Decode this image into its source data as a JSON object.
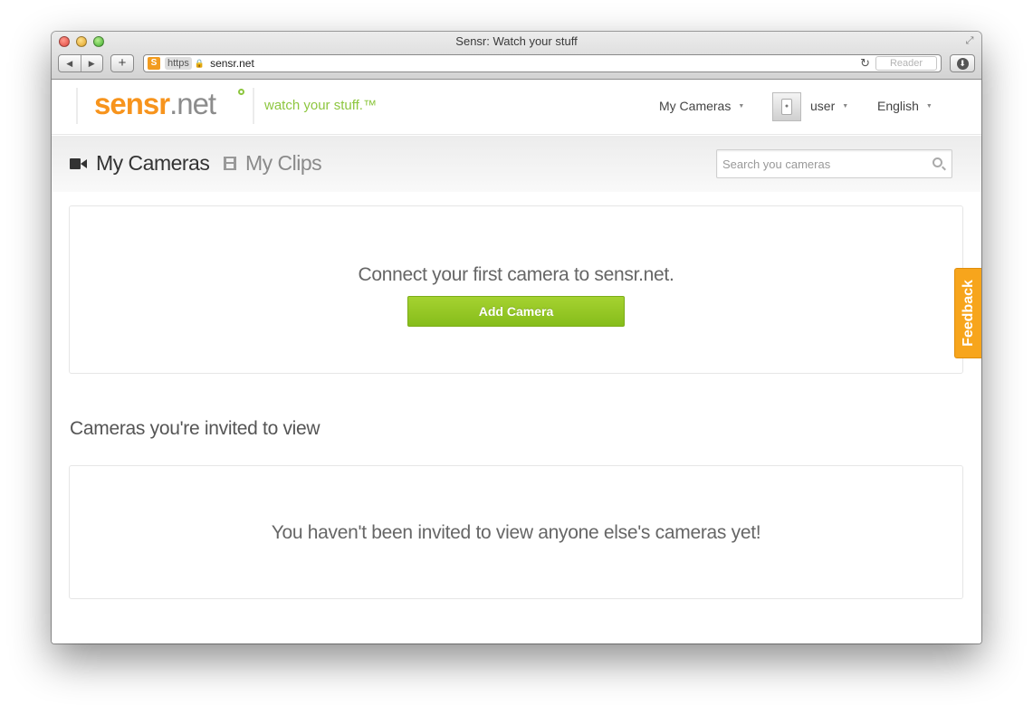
{
  "browser": {
    "window_title": "Sensr: Watch your stuff",
    "favicon_letter": "S",
    "url_scheme": "https",
    "url": "sensr.net",
    "reader_label": "Reader",
    "nav_back_glyph": "◀",
    "nav_forward_glyph": "▶",
    "new_tab_glyph": "+",
    "reload_glyph": "↻"
  },
  "header": {
    "logo_sensr": "sensr",
    "logo_net": ".net",
    "tagline": "watch your stuff.™",
    "menu_my_cameras": "My Cameras",
    "user_name": "user",
    "language": "English"
  },
  "tabs": {
    "my_cameras": "My Cameras",
    "my_clips": "My Clips"
  },
  "search": {
    "placeholder": "Search you cameras"
  },
  "cameras_panel": {
    "message": "Connect your first camera to sensr.net.",
    "add_button_label": "Add Camera"
  },
  "invited": {
    "title": "Cameras you're invited to view",
    "message": "You haven't been invited to view anyone else's cameras yet!"
  },
  "feedback_label": "Feedback",
  "colors": {
    "brand_orange": "#f7941d",
    "brand_green": "#8dc63f",
    "button_green": "#94c621",
    "feedback_orange": "#f7a51c"
  }
}
